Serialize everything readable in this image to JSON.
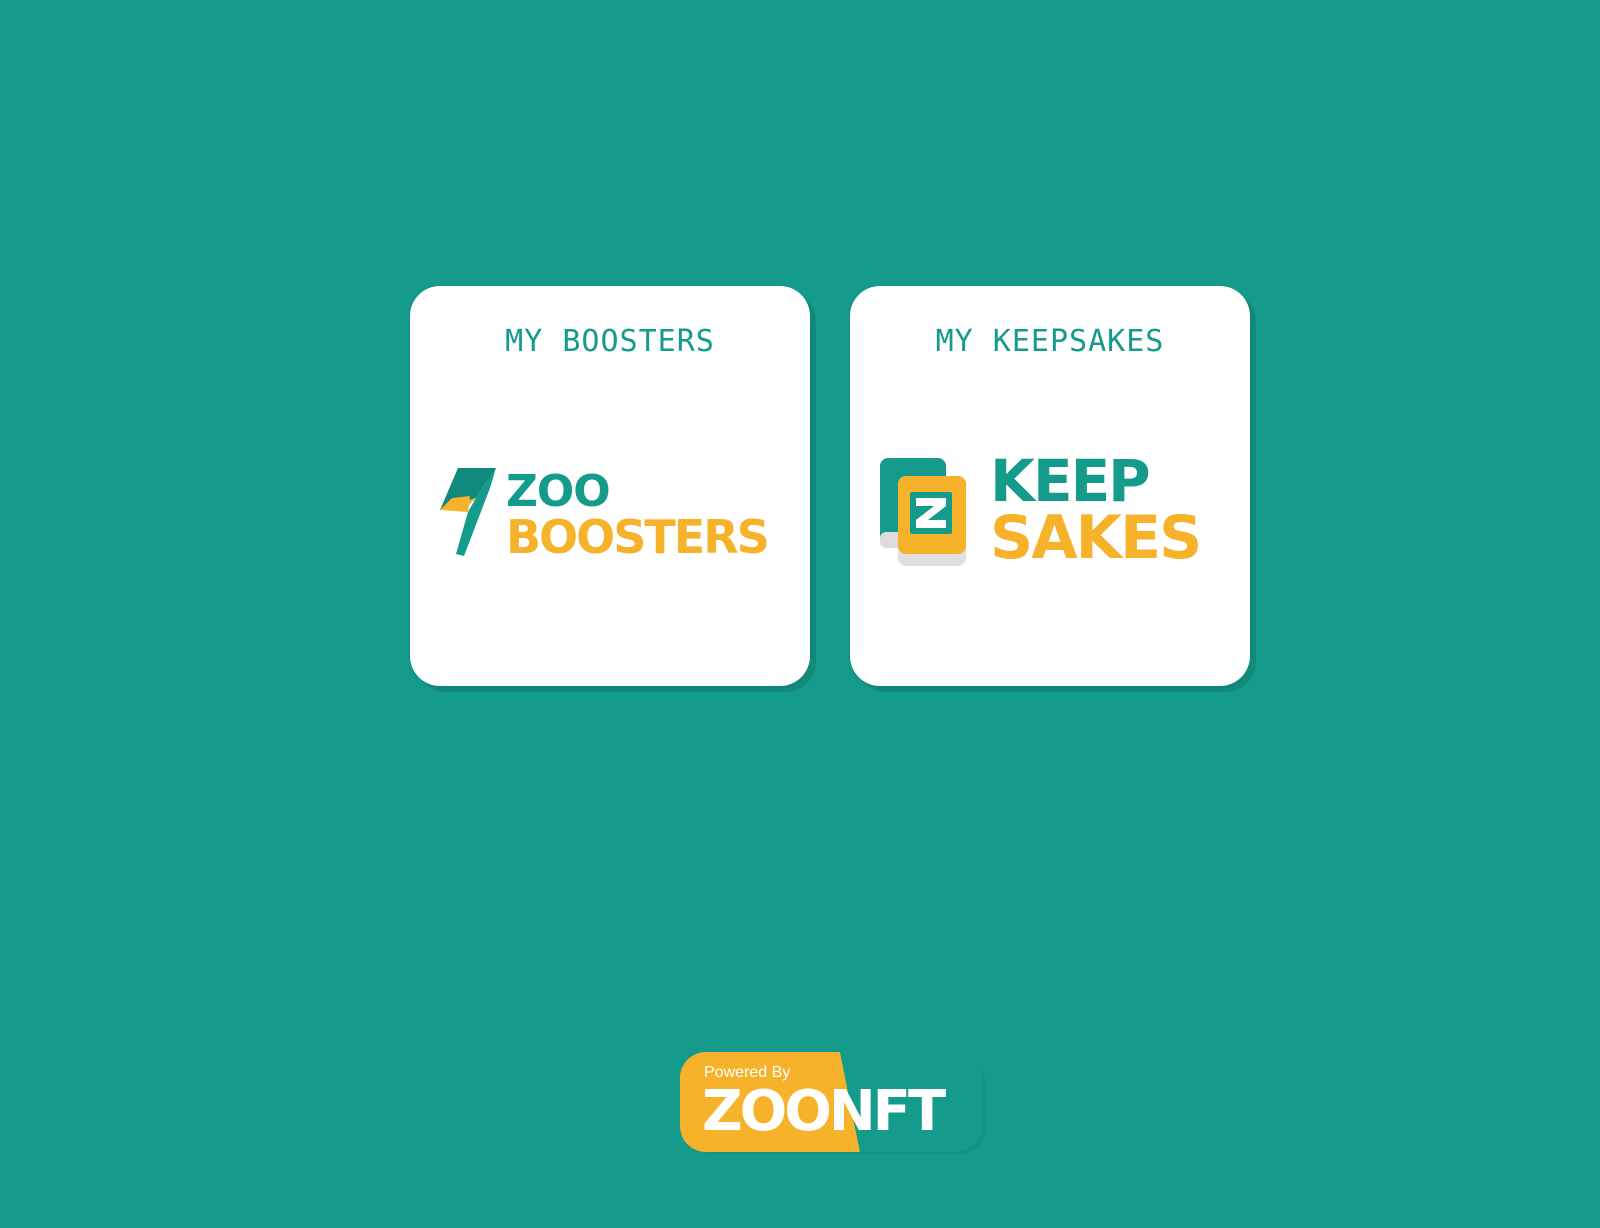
{
  "colors": {
    "background": "#159b8b",
    "teal": "#159b8b",
    "yellow": "#f7b22b",
    "card": "#ffffff"
  },
  "cards": [
    {
      "title": "MY BOOSTERS",
      "logo_top": "ZOO",
      "logo_bottom": "BOOSTERS",
      "icon": "lightning-bolt-icon"
    },
    {
      "title": "MY KEEPSAKES",
      "logo_top": "KEEP",
      "logo_bottom": "SAKES",
      "icon": "stacked-cards-z-icon"
    }
  ],
  "footer": {
    "powered_by": "Powered By",
    "brand": "ZOONFT"
  }
}
